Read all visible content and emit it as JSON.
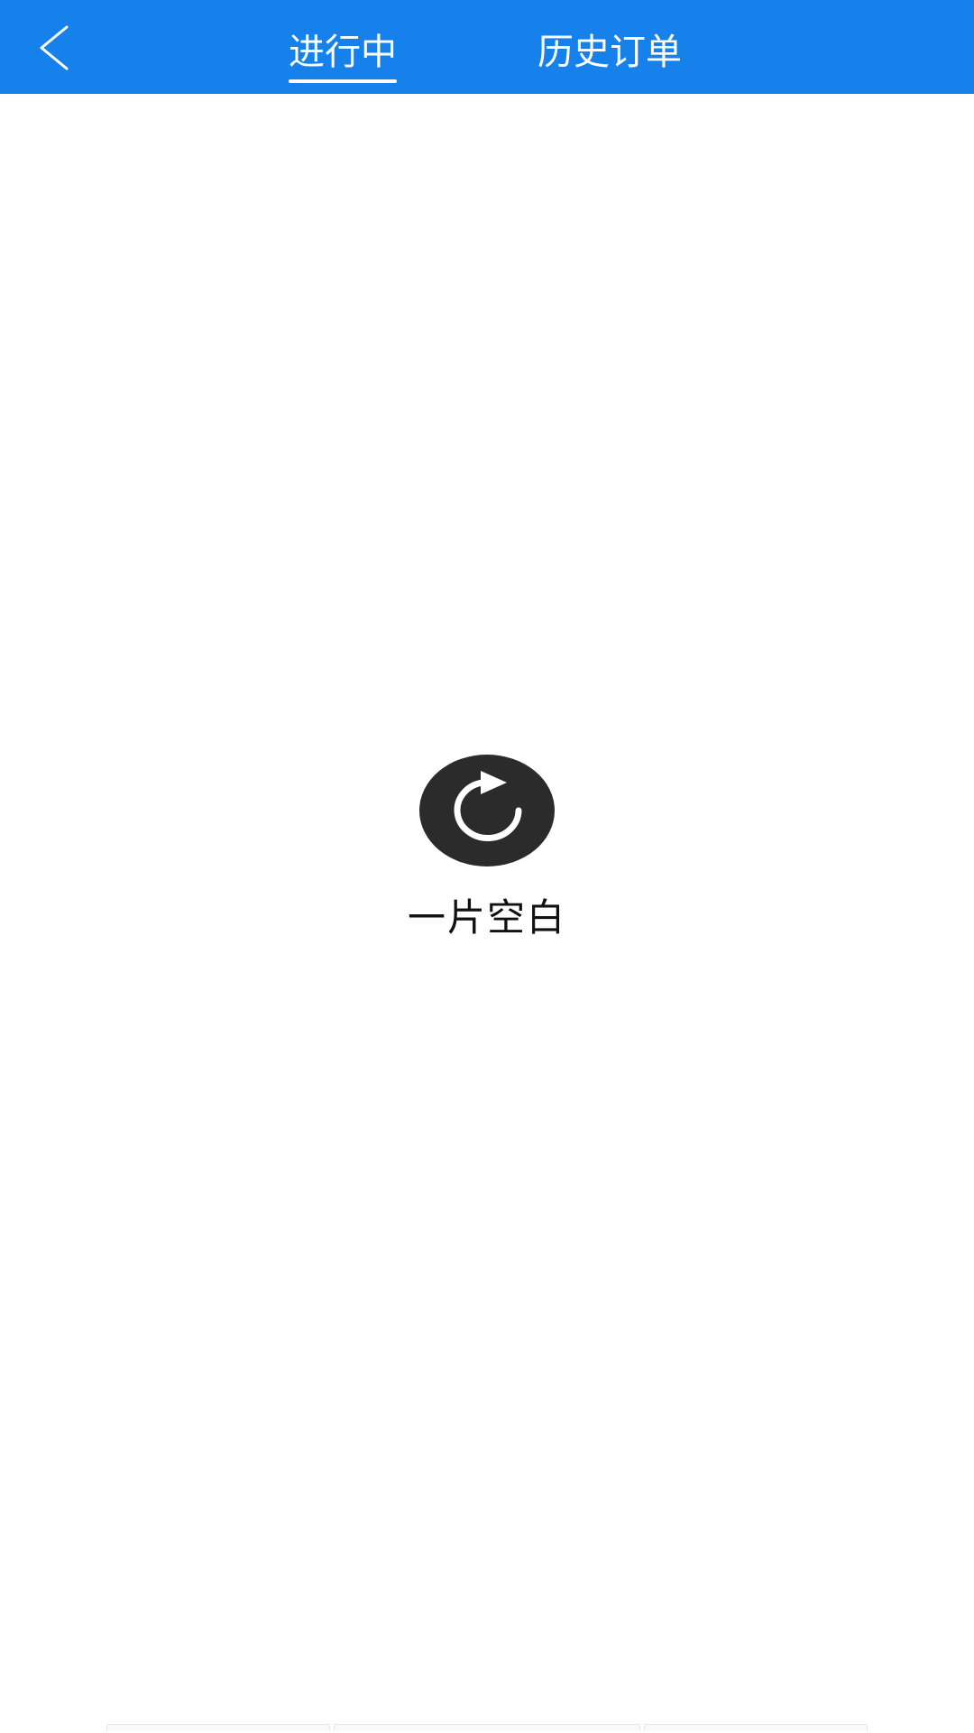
{
  "header": {
    "background": "#1681eb",
    "back_icon": "chevron-left-icon",
    "tabs": [
      {
        "label": "进行中",
        "active": true
      },
      {
        "label": "历史订单",
        "active": false
      }
    ]
  },
  "empty_state": {
    "icon": "refresh-icon",
    "icon_color": "#2b2b2b",
    "message": "一片空白"
  }
}
